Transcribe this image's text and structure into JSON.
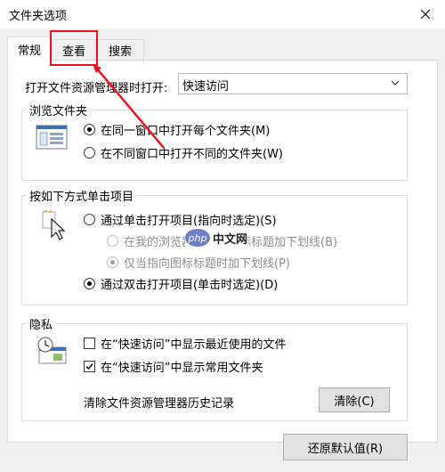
{
  "window": {
    "title": "文件夹选项"
  },
  "tabs": [
    {
      "label": "常规",
      "active": true
    },
    {
      "label": "查看",
      "active": false
    },
    {
      "label": "搜索",
      "active": false
    }
  ],
  "open_explorer": {
    "label": "打开文件资源管理器时打开:",
    "selected": "快速访问"
  },
  "browse_folders": {
    "title": "浏览文件夹",
    "options": [
      {
        "label": "在同一窗口中打开每个文件夹(M)",
        "checked": true
      },
      {
        "label": "在不同窗口中打开不同的文件夹(W)",
        "checked": false
      }
    ]
  },
  "click_items": {
    "title": "按如下方式单击项目",
    "options": [
      {
        "label": "通过单击打开项目(指向时选定)(S)",
        "checked": false,
        "disabled": false
      },
      {
        "label": "在我的浏览器一致的图标标题加下划线(B)",
        "checked": false,
        "disabled": true
      },
      {
        "label": "仅当指向图标标题时加下划线(P)",
        "checked": true,
        "disabled": true
      },
      {
        "label": "通过双击打开项目(单击时选定)(D)",
        "checked": true,
        "disabled": false
      }
    ]
  },
  "privacy": {
    "title": "隐私",
    "checks": [
      {
        "label": "在“快速访问”中显示最近使用的文件",
        "checked": false
      },
      {
        "label": "在“快速访问”中显示常用文件夹",
        "checked": true
      }
    ],
    "clear_history_label": "清除文件资源管理器历史记录",
    "clear_button": "清除(C)"
  },
  "restore_button": "还原默认值(R)",
  "watermark": {
    "badge": "php",
    "text": "中文网"
  },
  "colors": {
    "annotation_red": "#e8131f",
    "watermark_badge": "#6f7fc4"
  }
}
